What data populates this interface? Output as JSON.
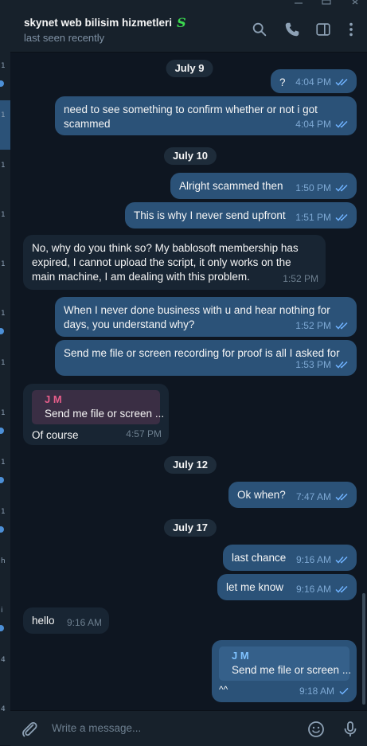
{
  "header": {
    "title": "skynet web bilisim hizmetleri",
    "title_emoji": "S",
    "status": "last seen recently",
    "icons": [
      "search-icon",
      "phone-icon",
      "sidebar-toggle-icon",
      "more-vertical-icon"
    ]
  },
  "colors": {
    "background": "#0e1621",
    "outgoing_bubble": "#2b5278",
    "incoming_bubble": "#182533",
    "panel": "#17212b",
    "reply_name_in": "#e55d8a",
    "reply_name_out": "#7fc2ff",
    "check": "#6fb3ff"
  },
  "left_strip": {
    "marks": [
      "1",
      "1",
      "1",
      "1",
      "1",
      "1",
      "1",
      "1",
      "1",
      "1",
      "h",
      "i",
      "4",
      "4"
    ]
  },
  "dates": {
    "d1": "July 9",
    "d2": "July 10",
    "d3": "July 12",
    "d4": "July 17"
  },
  "messages": [
    {
      "dir": "out",
      "text": "?",
      "time": "4:04 PM",
      "read": true
    },
    {
      "dir": "out",
      "text": "need to see something to confirm whether or not i got scammed",
      "time": "4:04 PM",
      "read": true
    },
    {
      "dir": "out",
      "text": "Alright scammed then",
      "time": "1:50 PM",
      "read": true
    },
    {
      "dir": "out",
      "text": "This is why I never send upfront",
      "time": "1:51 PM",
      "read": true
    },
    {
      "dir": "in",
      "text": "No, why do you think so? My bablosoft membership has expired, I cannot upload the script, it only works on the main machine, I am dealing with this problem.",
      "time": "1:52 PM"
    },
    {
      "dir": "out",
      "text": "When I never done business with u and hear nothing for days, you understand why?",
      "time": "1:52 PM",
      "read": true
    },
    {
      "dir": "out",
      "text": "Send me file or screen recording for proof is all I asked for",
      "time": "1:53 PM",
      "read": true
    },
    {
      "dir": "in",
      "reply_name": "J M",
      "reply_text": "Send me file or screen ...",
      "text": "Of course",
      "time": "4:57 PM"
    },
    {
      "dir": "out",
      "text": "Ok when?",
      "time": "7:47 AM",
      "read": true
    },
    {
      "dir": "out",
      "text": "last chance",
      "time": "9:16 AM",
      "read": true
    },
    {
      "dir": "out",
      "text": "let me know",
      "time": "9:16 AM",
      "read": true
    },
    {
      "dir": "in",
      "text": "hello",
      "time": "9:16 AM"
    },
    {
      "dir": "out",
      "reply_name": "J M",
      "reply_text": "Send me file or screen ...",
      "text": "^^",
      "time": "9:18 AM",
      "read": false
    }
  ],
  "composer": {
    "placeholder": "Write a message...",
    "icons": [
      "attach-icon",
      "emoji-icon",
      "microphone-icon"
    ]
  }
}
